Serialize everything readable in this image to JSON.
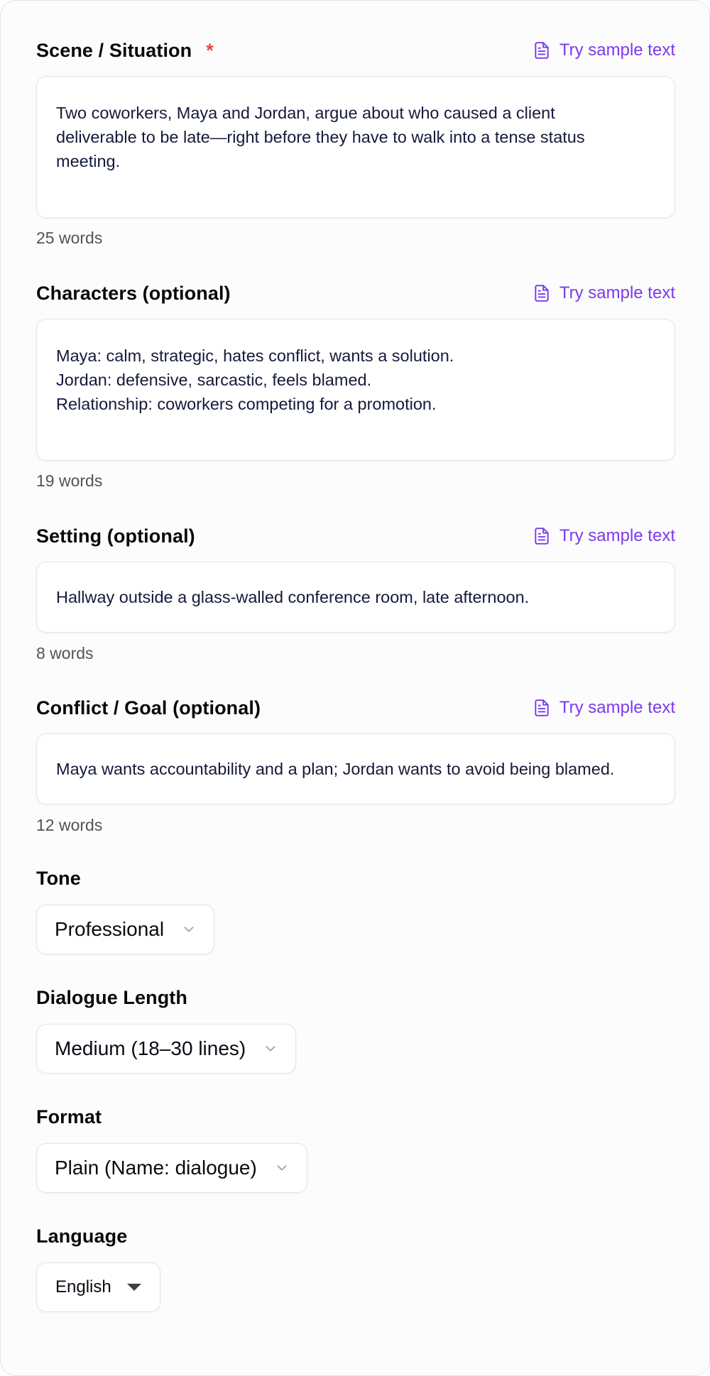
{
  "sample_label": "Try sample text",
  "scene": {
    "label": "Scene / Situation",
    "required_mark": "*",
    "value": "Two coworkers, Maya and Jordan, argue about who caused a client\ndeliverable to be late—right before they have to walk into a tense status\nmeeting.",
    "word_count": "25 words"
  },
  "characters": {
    "label": "Characters (optional)",
    "value": "Maya: calm, strategic, hates conflict, wants a solution.\nJordan: defensive, sarcastic, feels blamed.\nRelationship: coworkers competing for a promotion.",
    "word_count": "19 words"
  },
  "setting": {
    "label": "Setting (optional)",
    "value": "Hallway outside a glass-walled conference room, late afternoon.",
    "word_count": "8 words"
  },
  "conflict": {
    "label": "Conflict / Goal (optional)",
    "value": "Maya wants accountability and a plan; Jordan wants to avoid being blamed.",
    "word_count": "12 words"
  },
  "tone": {
    "label": "Tone",
    "value": "Professional"
  },
  "length": {
    "label": "Dialogue Length",
    "value": "Medium (18–30 lines)"
  },
  "format": {
    "label": "Format",
    "value": "Plain (Name: dialogue)"
  },
  "language": {
    "label": "Language",
    "value": "English"
  },
  "colors": {
    "accent": "#7c3aed",
    "required": "#e5484d"
  }
}
